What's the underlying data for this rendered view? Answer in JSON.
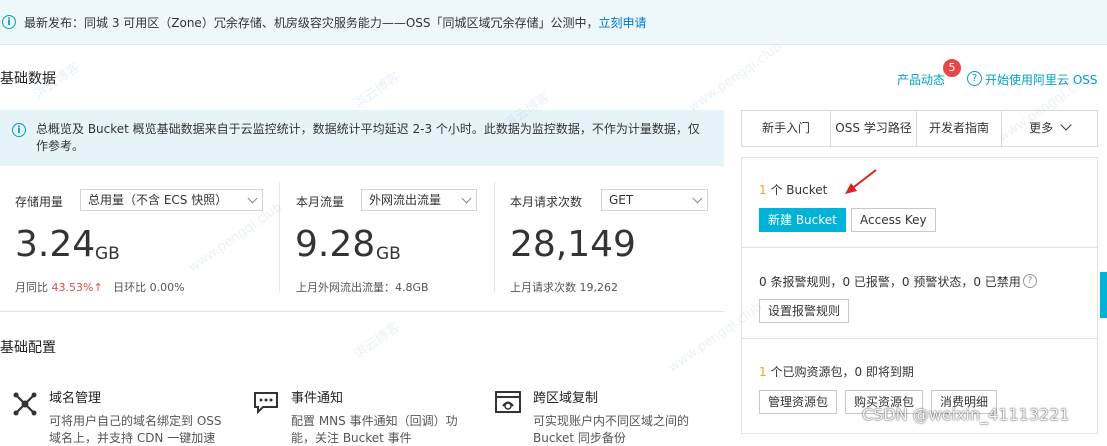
{
  "banner": {
    "icon": "info-icon",
    "text": "最新发布：同城 3 可用区（Zone）冗余存储、机房级容灾服务能力——OSS「同城区域冗余存储」公测中，",
    "link": "立刻申请"
  },
  "basic_data": {
    "title": "基础数据",
    "product_news": "产品动态",
    "news_badge": "5",
    "start_using": "开始使用阿里云 OSS",
    "notice": "总概览及 Bucket 概览基础数据来自于云监控统计，数据统计平均延迟 2-3 个小时。此数据为监控数据，不作为计量数据，仅作参考。"
  },
  "storage": {
    "label": "存储用量",
    "select": "总用量（不含 ECS 快照）",
    "value": "3.24",
    "unit": "GB",
    "yoy_label": "月同比",
    "yoy_value": "43.53%",
    "yoy_arrow": "↑",
    "mom_label": "日环比",
    "mom_value": "0.00%"
  },
  "traffic": {
    "label": "本月流量",
    "select": "外网流出流量",
    "value": "9.28",
    "unit": "GB",
    "sub": "上月外网流出流量：4.8GB"
  },
  "requests": {
    "label": "本月请求次数",
    "select": "GET",
    "value": "28,149",
    "sub": "上月请求次数 19,262"
  },
  "tabs": [
    "新手入门",
    "OSS 学习路径",
    "开发者指南",
    "更多"
  ],
  "bucket_panel": {
    "count": "1",
    "count_label": " 个 Bucket",
    "create": "新建 Bucket",
    "access_key": "Access Key"
  },
  "alarm_panel": {
    "text": "0 条报警规则，0 已报警，0 预警状态，0 已禁用",
    "button": "设置报警规则"
  },
  "resource_panel": {
    "count": "1",
    "text": " 个已购资源包，0 即将到期",
    "buttons": [
      "管理资源包",
      "购买资源包",
      "消费明细"
    ]
  },
  "basic_config": {
    "title": "基础配置",
    "features": [
      {
        "icon": "domain-icon",
        "title": "域名管理",
        "line1": "可将用户自己的域名绑定到 OSS",
        "line2": "域名上，并支持 CDN 一键加速"
      },
      {
        "icon": "message-icon",
        "title": "事件通知",
        "line1": "配置 MNS 事件通知（回调）功",
        "line2": "能，关注 Bucket 事件"
      },
      {
        "icon": "cross-region-icon",
        "title": "跨区域复制",
        "line1": "可实现账户内不同区域之间的",
        "line2": "Bucket 同步备份"
      }
    ]
  },
  "watermark_text": "淇云博客",
  "watermark_url": "www.pengqi.club",
  "csdn": "CSDN @weixin_41113221",
  "colors": {
    "accent": "#00a2ca",
    "primary_btn": "#00b3d6",
    "up": "#e54848",
    "badge": "#e54848"
  }
}
